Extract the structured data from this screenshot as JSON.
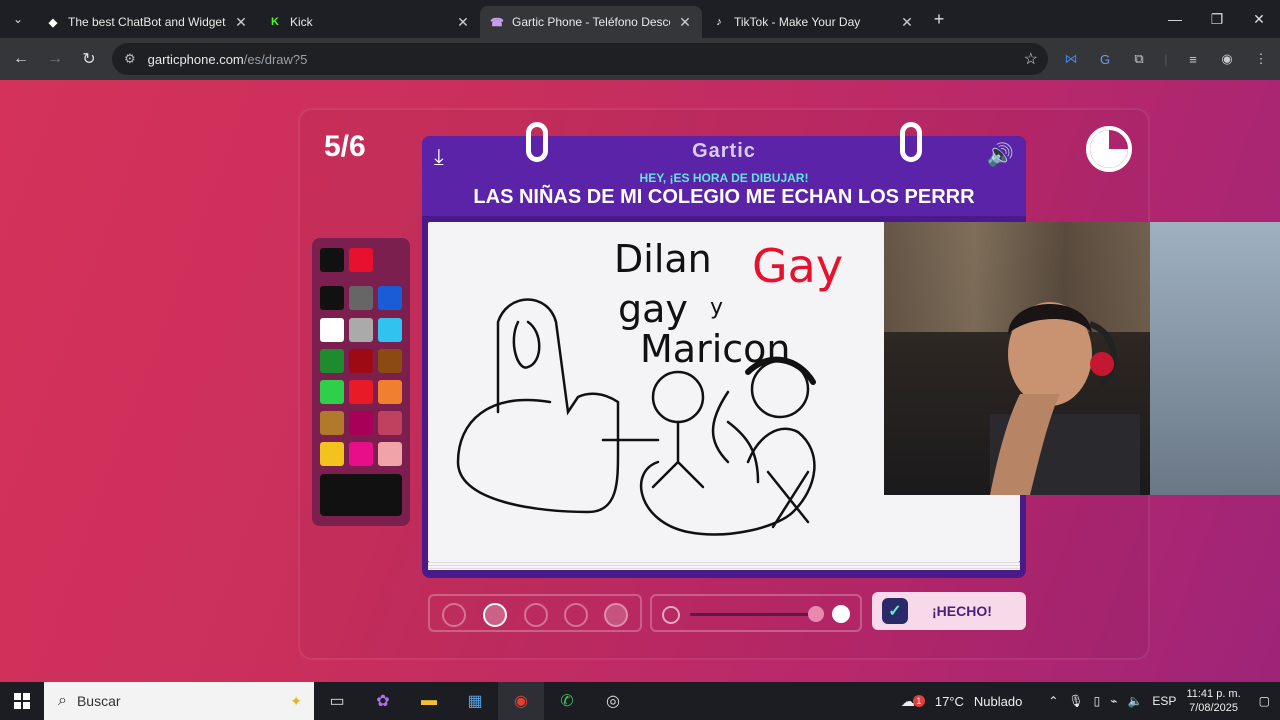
{
  "browser": {
    "tabs": [
      {
        "title": "The best ChatBot and Widgets",
        "favicon": "chatbot-icon",
        "active": false
      },
      {
        "title": "Kick",
        "favicon": "kick-icon",
        "active": false
      },
      {
        "title": "Gartic Phone - Teléfono Descon",
        "favicon": "gartic-icon",
        "active": true
      },
      {
        "title": "TikTok - Make Your Day",
        "favicon": "tiktok-icon",
        "active": false
      }
    ],
    "url_host": "garticphone.com",
    "url_path": "/es/draw?5"
  },
  "game": {
    "round": "5/6",
    "logo": "Gartic",
    "hint": "HEY, ¡ES HORA DE DIBUJAR!",
    "phrase": "LAS NIÑAS DE MI COLEGIO ME ECHAN LOS PERRR",
    "done_label": "¡HECHO!",
    "timer_elapsed_fraction": 0.25,
    "colors": {
      "accent": "#5a23a8",
      "background": "#c92f5c",
      "hint_color": "#5fe6e0"
    },
    "palette": [
      "#111111",
      "#e8112d",
      "#111111",
      "#666666",
      "#1a5bd6",
      "#ffffff",
      "#aaaaaa",
      "#31c3ef",
      "#1e8b2e",
      "#9e0a14",
      "#8a4a12",
      "#2ed04a",
      "#e81a28",
      "#f08030",
      "#b07a2a",
      "#a80058",
      "#c04060",
      "#f2c21e",
      "#e80e8a",
      "#f0a4a8"
    ],
    "selected_color": "#111111",
    "brush_sizes": 5,
    "selected_brush": 1
  },
  "drawing": {
    "text_lines": [
      "Dilan",
      "gay",
      "y",
      "Maricon"
    ],
    "red_text": "Gay"
  },
  "taskbar": {
    "search_placeholder": "Buscar",
    "weather_temp": "17°C",
    "weather_desc": "Nublado",
    "weather_badge": "1",
    "language": "ESP",
    "time": "11:41 p. m.",
    "date": "7/08/2025"
  }
}
